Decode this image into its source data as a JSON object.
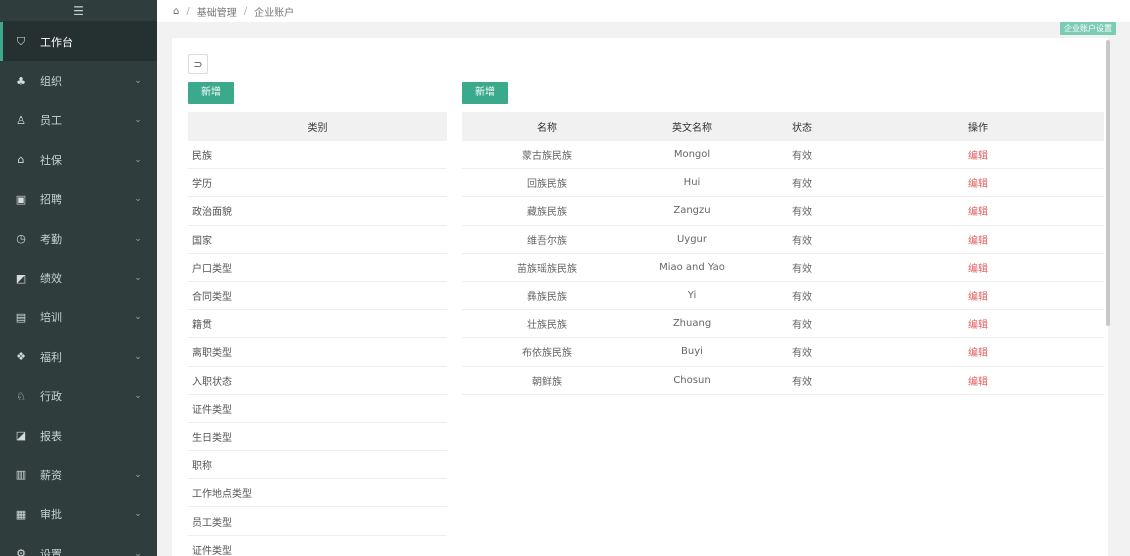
{
  "sidebar": {
    "menu_icon": "☰",
    "items": [
      {
        "label": "工作台",
        "icon": "shield-icon",
        "glyph": "⛉",
        "active": true,
        "chevron": ""
      },
      {
        "label": "组织",
        "icon": "org-icon",
        "glyph": "♣",
        "active": false,
        "chevron": "⌄"
      },
      {
        "label": "员工",
        "icon": "person-icon",
        "glyph": "♙",
        "active": false,
        "chevron": "⌄"
      },
      {
        "label": "社保",
        "icon": "house-icon",
        "glyph": "⌂",
        "active": false,
        "chevron": "⌄"
      },
      {
        "label": "招聘",
        "icon": "card-icon",
        "glyph": "▣",
        "active": false,
        "chevron": "⌄"
      },
      {
        "label": "考勤",
        "icon": "clock-icon",
        "glyph": "◷",
        "active": false,
        "chevron": "⌄"
      },
      {
        "label": "绩效",
        "icon": "chart-icon",
        "glyph": "◩",
        "active": false,
        "chevron": "⌄"
      },
      {
        "label": "培训",
        "icon": "book-icon",
        "glyph": "▤",
        "active": false,
        "chevron": "⌄"
      },
      {
        "label": "福利",
        "icon": "gift-icon",
        "glyph": "❖",
        "active": false,
        "chevron": "⌄"
      },
      {
        "label": "行政",
        "icon": "admin-icon",
        "glyph": "♘",
        "active": false,
        "chevron": "⌄"
      },
      {
        "label": "报表",
        "icon": "report-icon",
        "glyph": "◪",
        "active": false,
        "chevron": ""
      },
      {
        "label": "薪资",
        "icon": "bar-chart-icon",
        "glyph": "▥",
        "active": false,
        "chevron": "⌄"
      },
      {
        "label": "审批",
        "icon": "approve-icon",
        "glyph": "▦",
        "active": false,
        "chevron": "⌄"
      },
      {
        "label": "设置",
        "icon": "settings-icon",
        "glyph": "⚙",
        "active": false,
        "chevron": "⌄"
      }
    ]
  },
  "breadcrumb": {
    "home_icon": "⌂",
    "items": [
      "基础管理",
      "企业账户"
    ]
  },
  "top_badge": "企业账户设置",
  "toolbar": {
    "back_glyph": "⊃",
    "left_add_label": "新增",
    "right_add_label": "新增"
  },
  "left_table": {
    "header": "类别",
    "rows": [
      "民族",
      "学历",
      "政治面貌",
      "国家",
      "户口类型",
      "合同类型",
      "籍贯",
      "离职类型",
      "入职状态",
      "证件类型",
      "生日类型",
      "职称",
      "工作地点类型",
      "员工类型",
      "证件类型"
    ]
  },
  "right_table": {
    "headers": [
      "名称",
      "英文名称",
      "状态",
      "操作"
    ],
    "rows": [
      {
        "name": "蒙古族民族",
        "en": "Mongol",
        "status": "有效",
        "action": "编辑"
      },
      {
        "name": "回族民族",
        "en": "Hui",
        "status": "有效",
        "action": "编辑"
      },
      {
        "name": "藏族民族",
        "en": "Zangzu",
        "status": "有效",
        "action": "编辑"
      },
      {
        "name": "维吾尔族",
        "en": "Uygur",
        "status": "有效",
        "action": "编辑"
      },
      {
        "name": "苗族瑶族民族",
        "en": "Miao and Yao",
        "status": "有效",
        "action": "编辑"
      },
      {
        "name": "彝族民族",
        "en": "Yi",
        "status": "有效",
        "action": "编辑"
      },
      {
        "name": "壮族民族",
        "en": "Zhuang",
        "status": "有效",
        "action": "编辑"
      },
      {
        "name": "布依族民族",
        "en": "Buyi",
        "status": "有效",
        "action": "编辑"
      },
      {
        "name": "朝鲜族",
        "en": "Chosun",
        "status": "有效",
        "action": "编辑"
      }
    ]
  },
  "colors": {
    "sidebar_bg": "#2f3d3d",
    "accent": "#3aa98c",
    "action": "#e06060"
  }
}
